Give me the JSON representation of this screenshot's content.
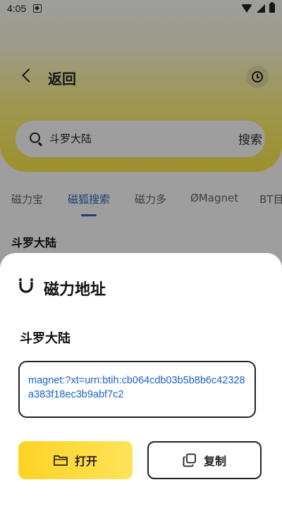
{
  "status": {
    "time": "4:05"
  },
  "topbar": {
    "back_label": "返回"
  },
  "search": {
    "query": "斗罗大陆",
    "submit_label": "搜索"
  },
  "tabs": [
    {
      "label": "磁力宝"
    },
    {
      "label": "磁狐搜索",
      "active": true
    },
    {
      "label": "磁力多"
    },
    {
      "label": "ØMagnet"
    },
    {
      "label": "BT目"
    }
  ],
  "results": {
    "first_title": "斗罗大陆"
  },
  "sheet": {
    "title": "磁力地址",
    "file_name": "斗罗大陆",
    "magnet_link": "magnet:?xt=urn:btih:cb064cdb03b5b8b6c42328a383f18ec3b9abf7c2",
    "open_label": "打开",
    "copy_label": "复制"
  },
  "colors": {
    "accent": "#ffd325",
    "link": "#1a62c7",
    "tab_active": "#2f66c7"
  }
}
